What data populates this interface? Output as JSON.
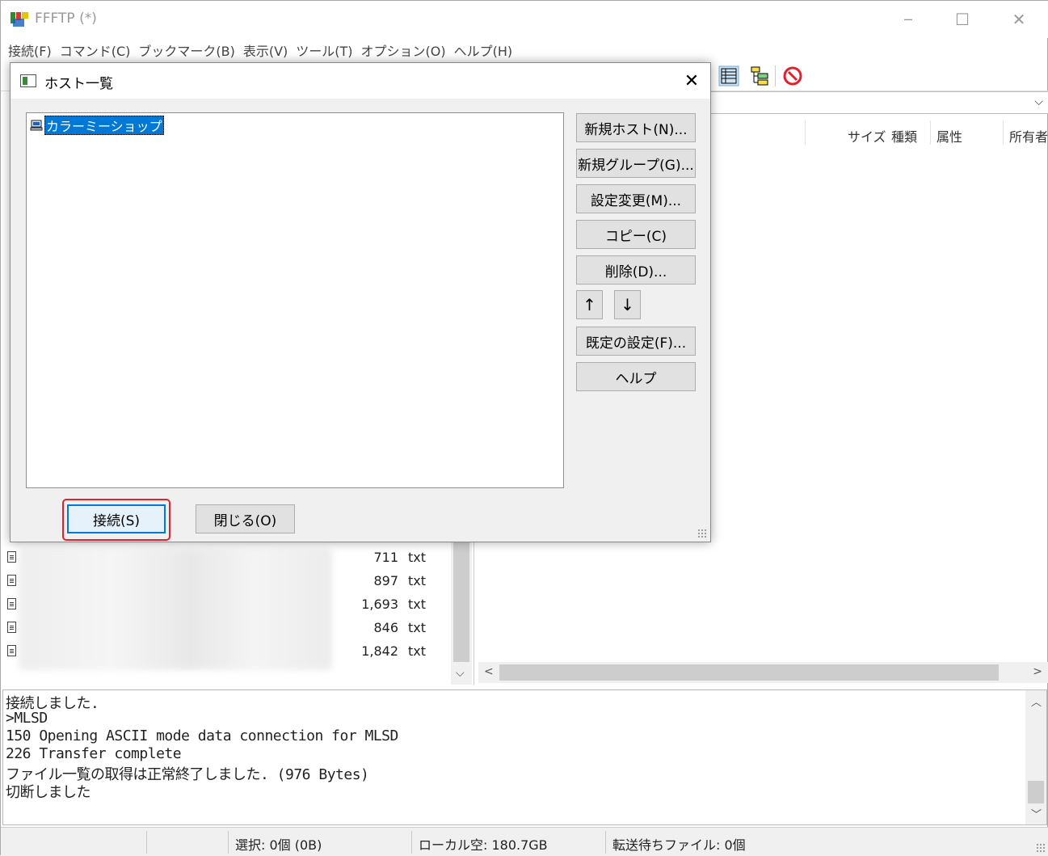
{
  "window": {
    "title": "FFFTP (*)",
    "controls": {
      "minimize": "─",
      "maximize": "☐",
      "close": "✕"
    }
  },
  "menu": [
    "接続(F)",
    "コマンド(C)",
    "ブックマーク(B)",
    "表示(V)",
    "ツール(T)",
    "オプション(O)",
    "ヘルプ(H)"
  ],
  "remote_columns": [
    "サイズ",
    "種類",
    "属性",
    "所有者"
  ],
  "local_files": [
    {
      "size": "711",
      "ext": "txt"
    },
    {
      "size": "897",
      "ext": "txt"
    },
    {
      "size": "1,693",
      "ext": "txt"
    },
    {
      "size": "846",
      "ext": "txt"
    },
    {
      "size": "1,842",
      "ext": "txt"
    }
  ],
  "log": [
    "接続しました.",
    ">MLSD",
    "150 Opening ASCII mode data connection for MLSD",
    "226 Transfer complete",
    "ファイル一覧の取得は正常終了しました. (976 Bytes)",
    "切断しました"
  ],
  "status": {
    "selection": "選択: 0個 (0B)",
    "local_free": "ローカル空: 180.7GB",
    "queue": "転送待ちファイル: 0個"
  },
  "dialog": {
    "title": "ホスト一覧",
    "close_glyph": "✕",
    "hosts": [
      "カラーミーショップ"
    ],
    "buttons": {
      "new_host": "新規ホスト(N)...",
      "new_group": "新規グループ(G)...",
      "edit": "設定変更(M)...",
      "copy": "コピー(C)",
      "delete": "削除(D)...",
      "up": "↑",
      "down": "↓",
      "defaults": "既定の設定(F)...",
      "help": "ヘルプ",
      "connect": "接続(S)",
      "close": "閉じる(O)"
    }
  },
  "colors": {
    "selection": "#0078d7",
    "highlight": "#e0202a",
    "button_face": "#e1e1e1"
  }
}
